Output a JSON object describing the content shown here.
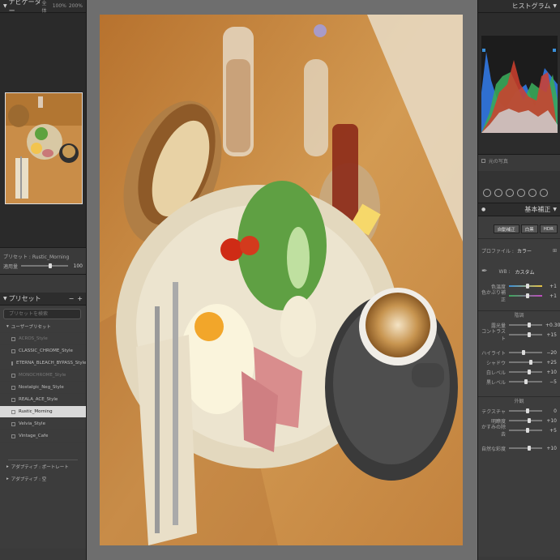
{
  "navigator": {
    "title": "ナビゲーター",
    "zoom_fit": "全体",
    "zoom_1": "100%",
    "zoom_2": "200%"
  },
  "preset_info": {
    "label": "プリセット : Rustic_Morning",
    "amount_label": "適用量",
    "amount_value": "100",
    "amount": 1.0
  },
  "presets": {
    "title": "プリセット",
    "search_placeholder": "プリセットを検索",
    "user_group": "ユーザープリセット",
    "items": [
      {
        "label": "ACROS_Style",
        "state": "dim"
      },
      {
        "label": "CLASSIC_CHROME_Style",
        "state": ""
      },
      {
        "label": "ETERNA_BLEACH_BYPASS_Style",
        "state": ""
      },
      {
        "label": "MONOCHROME_Style",
        "state": "dim"
      },
      {
        "label": "Nostalgic_Neg_Style",
        "state": ""
      },
      {
        "label": "REALA_ACE_Style",
        "state": ""
      },
      {
        "label": "Rustic_Morning",
        "state": "sel"
      },
      {
        "label": "Velvia_Style",
        "state": ""
      },
      {
        "label": "Vintage_Cafe",
        "state": ""
      }
    ],
    "adaptive_portrait": "アダプティブ : ポートレート",
    "adaptive_sky": "アダプティブ : 空"
  },
  "histogram": {
    "title": "ヒストグラム",
    "original_photo": "元の写真"
  },
  "basic": {
    "title": "基本補正",
    "auto_label": "自動補正",
    "color_label": "白黒",
    "hdr_label": "HDR",
    "profile_label": "プロファイル :",
    "profile_value": "カラー",
    "wb_label": "WB :",
    "wb_value": "カスタム",
    "temp_label": "色温度",
    "temp_value": "+1",
    "tint_label": "色かぶり補正",
    "tint_value": "+1",
    "tone_group": "階調",
    "exposure_label": "露光量",
    "exposure_value": "+0.30",
    "contrast_label": "コントラスト",
    "contrast_value": "+15",
    "highlights_label": "ハイライト",
    "highlights_value": "−20",
    "shadows_label": "シャドウ",
    "shadows_value": "+25",
    "whites_label": "白レベル",
    "whites_value": "+10",
    "blacks_label": "黒レベル",
    "blacks_value": "−5",
    "presence_group": "外観",
    "texture_label": "テクスチャ",
    "texture_value": "0",
    "clarity_label": "明瞭度",
    "clarity_value": "+10",
    "dehaze_label": "かすみの除去",
    "dehaze_value": "+5",
    "vibrance_label": "自然な彩度",
    "vibrance_value": "+10"
  },
  "colors": {
    "accent": "#3a8fd9",
    "panel": "#3a3a3a",
    "hist_red": "#d0402e",
    "hist_green": "#3aa85a",
    "hist_blue": "#2f6fd0"
  }
}
